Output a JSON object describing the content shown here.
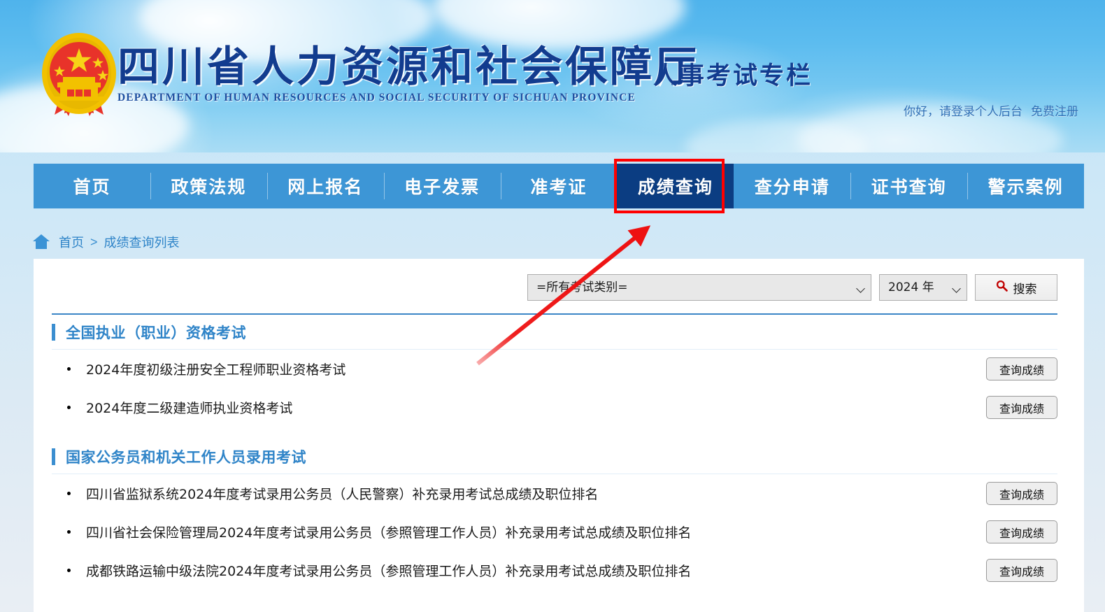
{
  "header": {
    "emblem_alt": "national-emblem",
    "title_cn": "四川省人力资源和社会保障厅",
    "title_en": "DEPARTMENT OF HUMAN RESOURCES AND SOCIAL SECURITY OF SICHUAN PROVINCE",
    "title_sub": "人事考试专栏",
    "greeting": "你好，请登录个人后台",
    "register": "免费注册"
  },
  "nav": {
    "items": [
      {
        "label": "首页",
        "active": false
      },
      {
        "label": "政策法规",
        "active": false
      },
      {
        "label": "网上报名",
        "active": false
      },
      {
        "label": "电子发票",
        "active": false
      },
      {
        "label": "准考证",
        "active": false
      },
      {
        "label": "成绩查询",
        "active": true
      },
      {
        "label": "查分申请",
        "active": false
      },
      {
        "label": "证书查询",
        "active": false
      },
      {
        "label": "警示案例",
        "active": false
      }
    ],
    "highlight_color": "#ff0000",
    "active_bg": "#0b3d82",
    "bar_bg": "#3d96d6"
  },
  "annotation": {
    "arrow_color": "#ee1111",
    "arrow_from": "683,518",
    "arrow_to": "922,330"
  },
  "breadcrumb": {
    "home_icon": "home-icon",
    "home": "首页",
    "separator": ">",
    "current": "成绩查询列表"
  },
  "search": {
    "category_value": "=所有考试类别=",
    "category_options": [
      "=所有考试类别="
    ],
    "year_value": "2024 年",
    "year_options": [
      "2024 年"
    ],
    "button_label": "搜索",
    "button_icon": "search-icon"
  },
  "sections": [
    {
      "title": "全国执业（职业）资格考试",
      "items": [
        {
          "name": "2024年度初级注册安全工程师职业资格考试",
          "action": "查询成绩"
        },
        {
          "name": "2024年度二级建造师执业资格考试",
          "action": "查询成绩"
        }
      ]
    },
    {
      "title": "国家公务员和机关工作人员录用考试",
      "items": [
        {
          "name": "四川省监狱系统2024年度考试录用公务员（人民警察）补充录用考试总成绩及职位排名",
          "action": "查询成绩"
        },
        {
          "name": "四川省社会保险管理局2024年度考试录用公务员（参照管理工作人员）补充录用考试总成绩及职位排名",
          "action": "查询成绩"
        },
        {
          "name": "成都铁路运输中级法院2024年度考试录用公务员（参照管理工作人员）补充录用考试总成绩及职位排名",
          "action": "查询成绩"
        }
      ]
    }
  ],
  "colors": {
    "accent_blue": "#2f84c8",
    "nav_blue": "#3d96d6",
    "active_navy": "#0b3d82",
    "annotation_red": "#ff0000",
    "title_navy": "#123c8f"
  }
}
